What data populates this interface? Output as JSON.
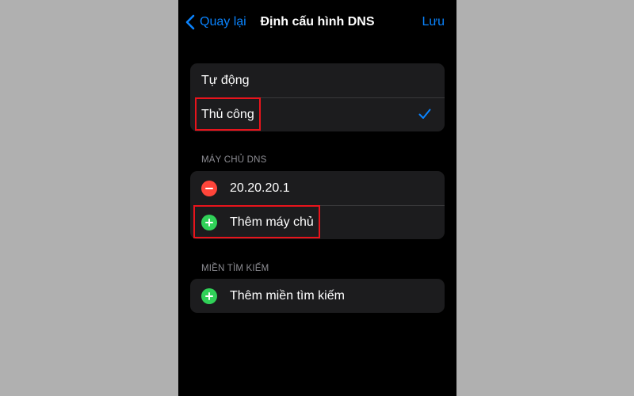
{
  "nav": {
    "back_label": "Quay lại",
    "title": "Định cấu hình DNS",
    "save_label": "Lưu"
  },
  "mode_group": {
    "items": [
      {
        "label": "Tự động",
        "selected": false
      },
      {
        "label": "Thủ công",
        "selected": true
      }
    ]
  },
  "dns_section": {
    "header": "MÁY CHỦ DNS",
    "servers": [
      "20.20.20.1"
    ],
    "add_label": "Thêm máy chủ"
  },
  "search_section": {
    "header": "MIỀN TÌM KIẾM",
    "add_label": "Thêm miền tìm kiếm"
  },
  "colors": {
    "accent": "#0a84ff",
    "delete": "#ff453a",
    "add": "#30d158",
    "highlight": "#e8141c"
  }
}
